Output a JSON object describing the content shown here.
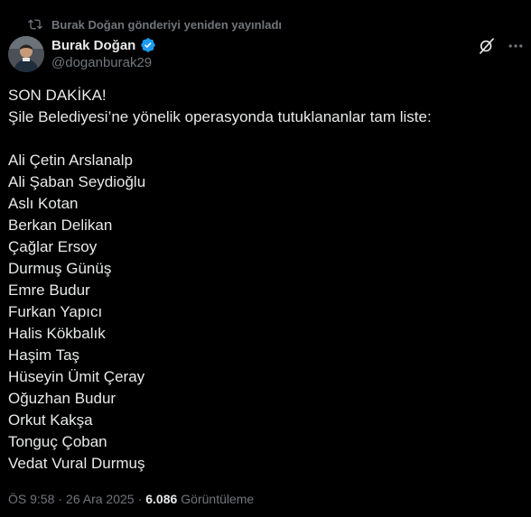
{
  "repost_banner": {
    "icon": "repost-icon",
    "text": "Burak Doğan gönderiyi yeniden yayınladı"
  },
  "author": {
    "display_name": "Burak Doğan",
    "handle": "@doganburak29",
    "verified": true,
    "verified_color": "#1d9bf0"
  },
  "actions": {
    "grok_icon": "grok-icon",
    "more_icon": "more-icon"
  },
  "post": {
    "headline": "SON DAKİKA!",
    "intro": "Şile Belediyesi’ne yönelik operasyonda tutuklananlar tam liste:",
    "names": [
      "Ali Çetin Arslanalp",
      "Ali Şaban Seydioğlu",
      "Aslı Kotan",
      "Berkan Delikan",
      "Çağlar Ersoy",
      "Durmuş Günüş",
      "Emre Budur",
      "Furkan Yapıcı",
      "Halis Kökbalık",
      "Haşim Taş",
      "Hüseyin Ümit Çeray",
      "Oğuzhan Budur",
      "Orkut Kakşa",
      "Tonguç Çoban",
      "Vedat Vural Durmuş"
    ]
  },
  "meta": {
    "time": "ÖS 9:58",
    "separator": "·",
    "date": "26 Ara 2025",
    "views_count": "6.086",
    "views_label": "Görüntüleme"
  },
  "colors": {
    "background": "#000000",
    "text": "#e7e9ea",
    "muted": "#71767b",
    "accent": "#1d9bf0"
  }
}
